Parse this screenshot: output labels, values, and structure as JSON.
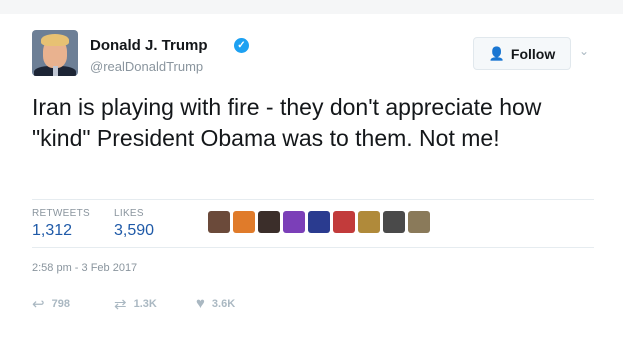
{
  "tweet": {
    "display_name": "Donald J. Trump",
    "handle": "@realDonaldTrump",
    "verified_icon": "verified-badge-icon",
    "follow_label": "Follow",
    "text": "Iran is playing with fire - they don't appreciate how \"kind\" President Obama was to them. Not me!",
    "retweets_label": "RETWEETS",
    "retweets_count": "1,312",
    "likes_label": "LIKES",
    "likes_count": "3,590",
    "timestamp": "2:58 pm - 3 Feb 2017",
    "actions": {
      "reply_count": "798",
      "retweet_count": "1.3K",
      "like_count": "3.6K"
    }
  },
  "colors": {
    "accent": "#1da1f2",
    "count_blue": "#1f5aa8",
    "muted": "#8a959e"
  },
  "liker_avatars": [
    "#6b4a3a",
    "#e07b2a",
    "#3b2e2a",
    "#7b3fb8",
    "#2a3b8f",
    "#c23b3b",
    "#b08a3a",
    "#4a4a4a",
    "#8a7a5a"
  ]
}
